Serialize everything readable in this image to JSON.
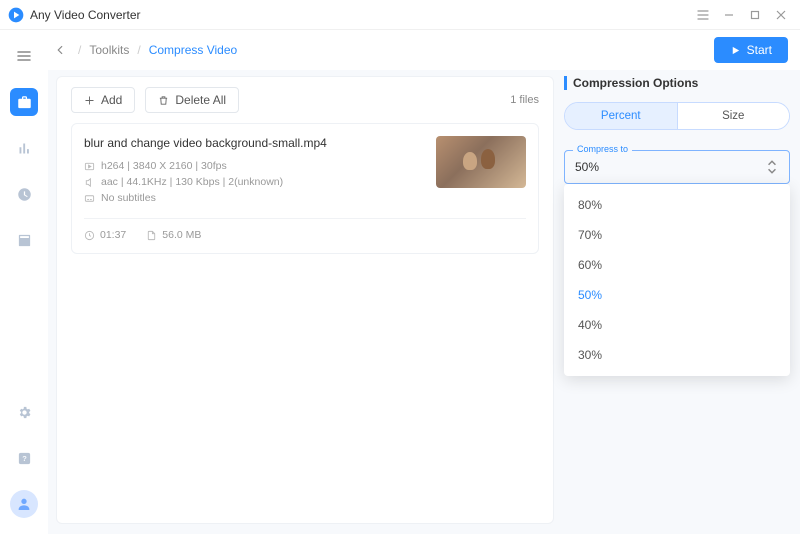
{
  "app": {
    "name": "Any Video Converter"
  },
  "breadcrumb": {
    "parent": "Toolkits",
    "current": "Compress Video"
  },
  "actions": {
    "start": "Start",
    "add": "Add",
    "deleteAll": "Delete All"
  },
  "fileList": {
    "countLabel": "1 files",
    "file": {
      "name": "blur and change video background-small.mp4",
      "videoMeta": "h264 | 3840 X 2160 | 30fps",
      "audioMeta": "aac | 44.1KHz | 130 Kbps | 2(unknown)",
      "subtitles": "No subtitles",
      "duration": "01:37",
      "size": "56.0 MB"
    }
  },
  "options": {
    "title": "Compression Options",
    "tabs": {
      "percent": "Percent",
      "size": "Size"
    },
    "compressLabel": "Compress to",
    "selected": "50%",
    "items": [
      "80%",
      "70%",
      "60%",
      "50%",
      "40%",
      "30%"
    ]
  }
}
